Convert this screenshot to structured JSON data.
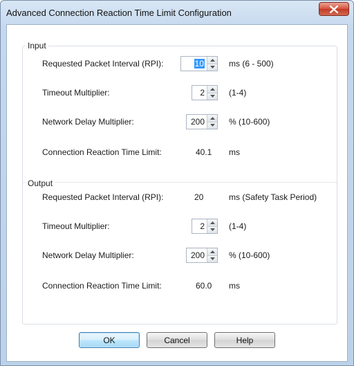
{
  "window": {
    "title": "Advanced Connection Reaction Time Limit Configuration"
  },
  "input": {
    "group_label": "Input",
    "rpi": {
      "label": "Requested Packet Interval (RPI):",
      "value": "10",
      "unit": "ms (6 - 500)"
    },
    "timeout": {
      "label": "Timeout Multiplier:",
      "value": "2",
      "unit": "(1-4)"
    },
    "network_delay": {
      "label": "Network Delay Multiplier:",
      "value": "200",
      "unit": "% (10-600)"
    },
    "crtl": {
      "label": "Connection Reaction Time Limit:",
      "value": "40.1",
      "unit": "ms"
    }
  },
  "output": {
    "group_label": "Output",
    "rpi": {
      "label": "Requested Packet Interval (RPI):",
      "value": "20",
      "unit": "ms (Safety Task Period)"
    },
    "timeout": {
      "label": "Timeout Multiplier:",
      "value": "2",
      "unit": "(1-4)"
    },
    "network_delay": {
      "label": "Network Delay Multiplier:",
      "value": "200",
      "unit": "% (10-600)"
    },
    "crtl": {
      "label": "Connection Reaction Time Limit:",
      "value": "60.0",
      "unit": "ms"
    }
  },
  "buttons": {
    "ok": "OK",
    "cancel": "Cancel",
    "help": "Help"
  },
  "colors": {
    "selection": "#3399ff",
    "close_button": "#c23a22",
    "title_bar": "#c4d8ee"
  }
}
